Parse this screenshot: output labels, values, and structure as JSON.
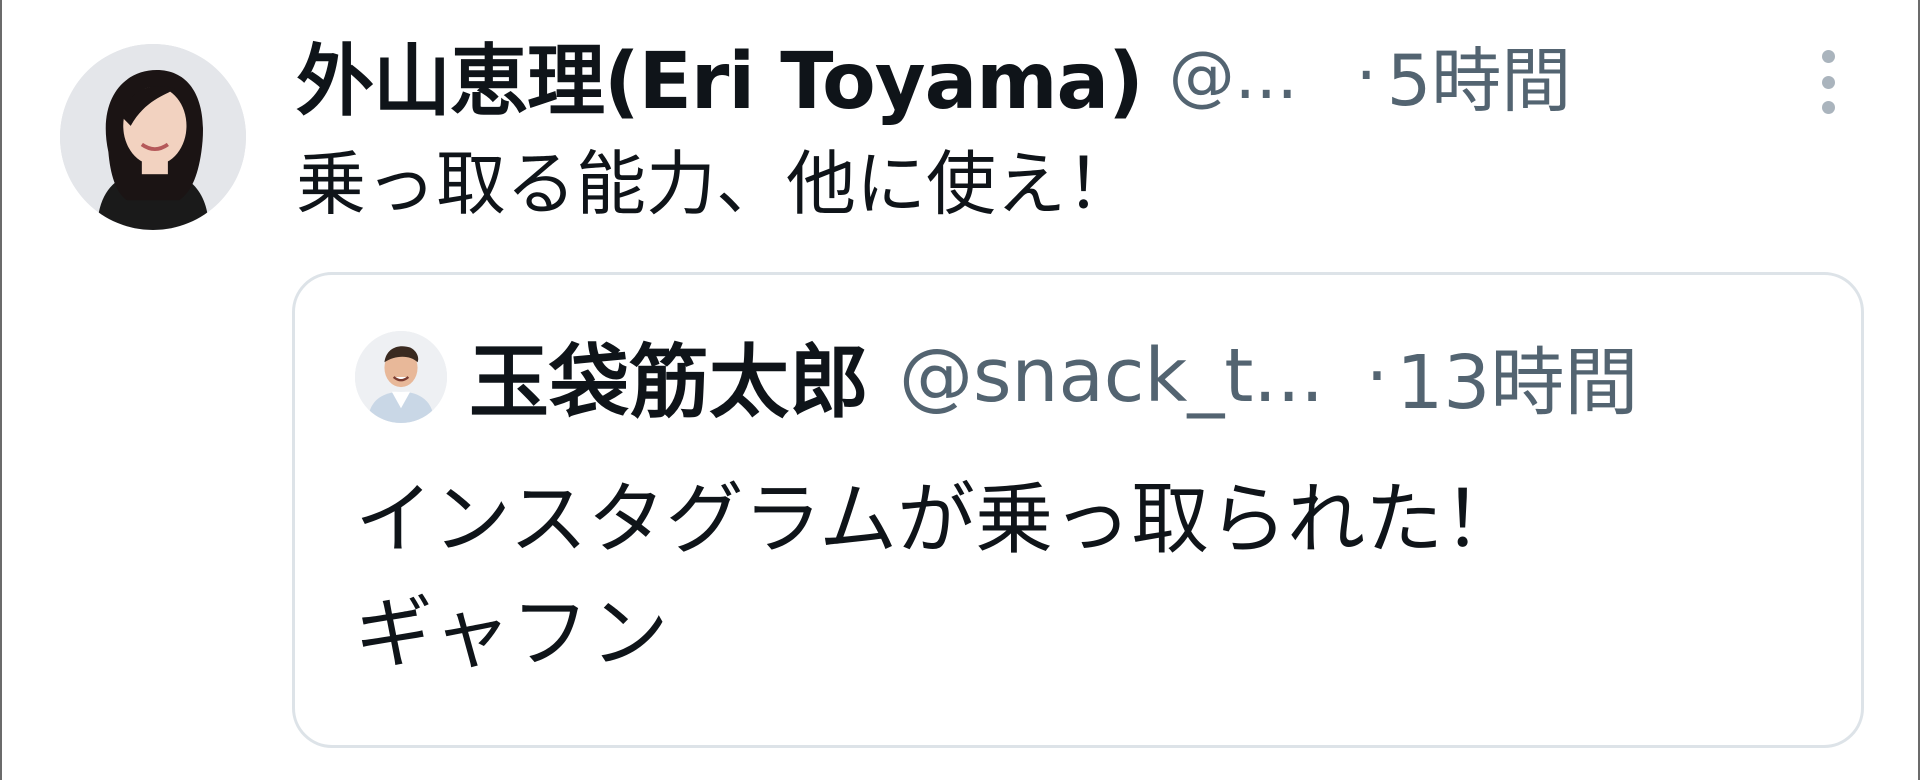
{
  "tweet": {
    "author": {
      "display_name": "外山恵理(Eri Toyama)",
      "handle": "@...",
      "avatar_icon": "profile-photo-woman"
    },
    "separator": "·",
    "time_ago": "5時間",
    "more_icon": "more-vertical-icon",
    "text": "乗っ取る能力、他に使え！"
  },
  "quoted_tweet": {
    "author": {
      "display_name": "玉袋筋太郎",
      "handle": "@snack_t...",
      "avatar_icon": "profile-photo-man"
    },
    "separator": "·",
    "time_ago": "13時間",
    "text_lines": [
      "インスタグラムが乗っ取られた！",
      "ギャフン"
    ]
  },
  "colors": {
    "text_primary": "#0f1419",
    "text_secondary": "#536471",
    "quote_border": "#dde3e8",
    "frame_border": "#6b6b6b"
  }
}
